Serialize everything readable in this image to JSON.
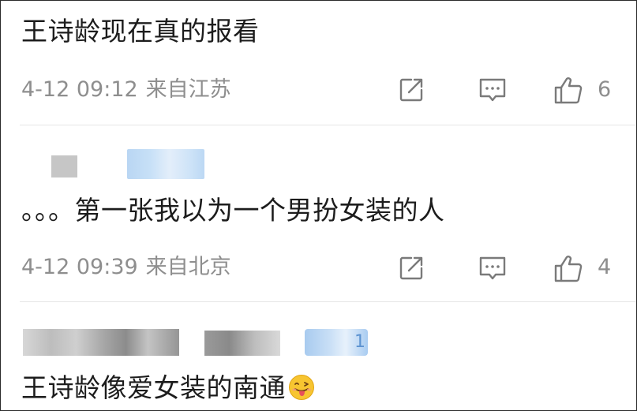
{
  "comments": [
    {
      "text": "王诗龄现在真的报看",
      "time": "4-12 09:12",
      "location": "来自江苏",
      "likes": "6"
    },
    {
      "text": "。。。第一张我以为一个男扮女装的人",
      "time": "4-12 09:39",
      "location": "来自北京",
      "likes": "4"
    },
    {
      "text": "王诗龄像爱女装的南通",
      "badge": "1"
    }
  ],
  "icons": {
    "share": "share-icon",
    "reply": "comment-icon",
    "like": "thumbs-up-icon",
    "emoji": "tongue-out-emoji"
  },
  "colors": {
    "meta": "#8e8e8e",
    "text": "#1c1c1c",
    "badge": "#5d93d1"
  }
}
